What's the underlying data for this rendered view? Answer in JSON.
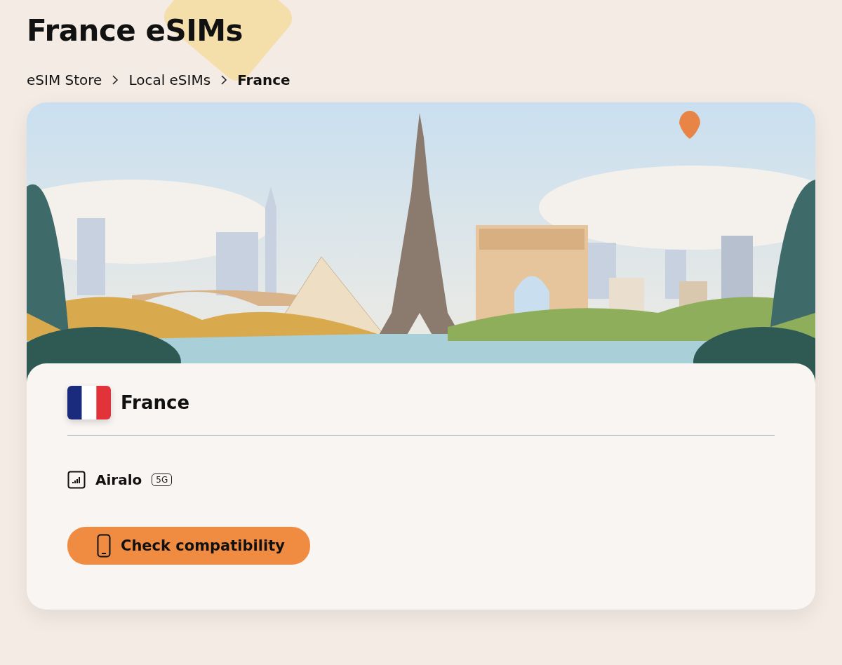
{
  "page": {
    "title": "France eSIMs"
  },
  "breadcrumbs": [
    {
      "label": "eSIM Store",
      "current": false
    },
    {
      "label": "Local eSIMs",
      "current": false
    },
    {
      "label": "France",
      "current": true
    }
  ],
  "card": {
    "country": "France",
    "operator": "Airalo",
    "network_badge": "5G",
    "button": "Check compatibility"
  }
}
